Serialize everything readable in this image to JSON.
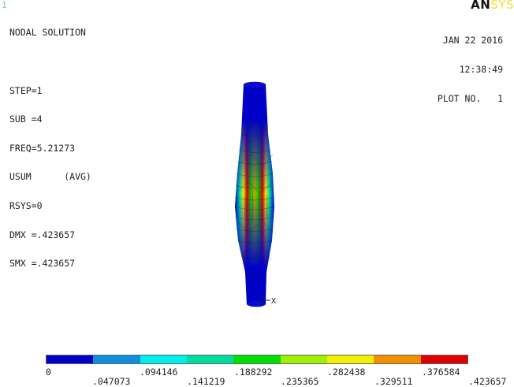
{
  "window_number": "1",
  "logo": {
    "prefix": "AN",
    "suffix": "SYS"
  },
  "info_lines": [
    "NODAL SOLUTION",
    "",
    "STEP=1",
    "SUB =4",
    "FREQ=5.21273",
    "USUM      (AVG)",
    "RSYS=0",
    "DMX =.423657",
    "SMX =.423657"
  ],
  "date": "JAN 22 2016",
  "time": "12:38:49",
  "plot_label": "PLOT NO.   1",
  "axis_label": "X",
  "legend": {
    "colors": [
      "#0000c8",
      "#0f8fdc",
      "#00f0f0",
      "#00dca0",
      "#00e000",
      "#a0f000",
      "#f0f000",
      "#f09000",
      "#e00000"
    ],
    "labels": [
      "0",
      ".047073",
      ".094146",
      ".141219",
      ".188292",
      ".235365",
      ".282438",
      ".329511",
      ".376584",
      ".423657"
    ]
  }
}
